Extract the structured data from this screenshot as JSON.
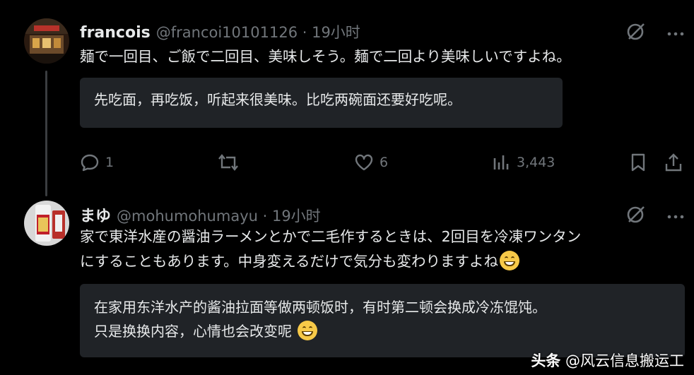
{
  "post1": {
    "name": "francois",
    "handle": "@francoi10101126 · 19小时",
    "text": "麺で一回目、ご飯で二回目、美味しそう。麺で二回より美味しいですよね。",
    "translation": "先吃面，再吃饭，听起来很美味。比吃两碗面还要好吃呢。",
    "replies": "1",
    "reposts": "",
    "likes": "6",
    "views": "3,443"
  },
  "post2": {
    "name": "まゆ",
    "handle": "@mohumohumayu · 19小时",
    "text_line1": "家で東洋水産の醤油ラーメンとかで二毛作するときは、2回目を冷凍ワンタン",
    "text_line2": "にすることもあります。中身変えるだけで気分も変わりますよね",
    "translation_line1": "在家用东洋水产的酱油拉面等做两顿饭时，有时第二顿会换成冷冻馄饨。",
    "translation_line2": "只是换换内容，心情也会改变呢"
  },
  "watermark": {
    "brand": "头条",
    "account": "@风云信息搬运工"
  },
  "icons": [
    "grok-icon",
    "more-icon",
    "reply-icon",
    "repost-icon",
    "like-icon",
    "views-icon",
    "bookmark-icon",
    "share-icon",
    "grin-emoji"
  ],
  "colors": {
    "background": "#000000",
    "text": "#e7e9ea",
    "muted": "#71767b",
    "translation_box": "#202327"
  }
}
